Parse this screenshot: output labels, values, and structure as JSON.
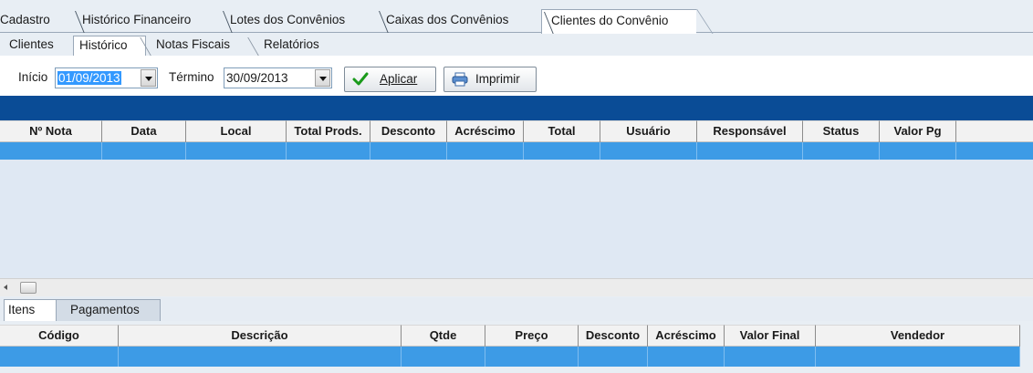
{
  "main_tabs": [
    {
      "label": "Cadastro"
    },
    {
      "label": "Histórico Financeiro"
    },
    {
      "label": "Lotes dos Convênios"
    },
    {
      "label": "Caixas dos Convênios"
    },
    {
      "label": "Clientes do Convênio",
      "active": true
    }
  ],
  "sub_tabs": [
    {
      "label": "Clientes"
    },
    {
      "label": "Histórico",
      "active": true
    },
    {
      "label": "Notas Fiscais"
    },
    {
      "label": "Relatórios"
    }
  ],
  "filter": {
    "start_label": "Início",
    "start_value": "01/09/2013",
    "end_label": "Término",
    "end_value": "30/09/2013",
    "apply_label": "Aplicar",
    "print_label": "Imprimir"
  },
  "notes_table": {
    "columns": [
      "Nº Nota",
      "Data",
      "Local",
      "Total Prods.",
      "Desconto",
      "Acréscimo",
      "Total",
      "Usuário",
      "Responsável",
      "Status",
      "Valor Pg"
    ]
  },
  "detail_tabs": [
    {
      "label": "Itens",
      "active": true
    },
    {
      "label": "Pagamentos"
    }
  ],
  "items_table": {
    "columns": [
      "Código",
      "Descrição",
      "Qtde",
      "Preço",
      "Desconto",
      "Acréscimo",
      "Valor Final",
      "Vendedor"
    ]
  },
  "colors": {
    "header_blue": "#0a4c96",
    "selection_blue": "#3d9be6",
    "apply_check": "#1a9a1a"
  },
  "icons": [
    "dropdown-arrow-icon",
    "check-icon",
    "printer-icon",
    "scroll-left-icon"
  ]
}
